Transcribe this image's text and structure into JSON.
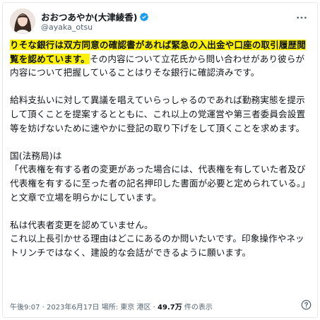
{
  "author": {
    "display_name": "おおつあやか(大津綾香)",
    "handle": "@ayaka_otsu",
    "verified": true,
    "verified_color": "#1d9bf0"
  },
  "post": {
    "p1_highlight": "りそな銀行は双方同意の確認書があれば緊急の入出金や口座の取引履歴閲覧を認めています。",
    "p1_rest": "その内容について立花氏から問い合わせがあり彼らが内容について把握していることはりそな銀行に確認済みです。",
    "p2": "給料支払いに対して異議を唱えていらっしゃるのであれば勤務実態を提示して頂くことを提案するとともに、これ以上の党運営や第三者委員会設置等を妨げないために速やかに登記の取り下げをして頂くことを求めます。",
    "p3": "国(法務局)は\n「代表権を有する者の変更があった場合には、代表権を有していた者及び代表権を有するに至った者の記名押印した書面が必要と定められている。」と文章で立場を明らかにしています。",
    "p4": "私は代表者変更を認めていません。\nこれ以上長引かせる理由はどこにあるのか問いたいです。印象操作やネットリンチではなく、建設的な会話ができるように願います。",
    "highlight_color": "#fff200"
  },
  "meta": {
    "time": "午後9:07",
    "date": "2023年6月17日",
    "location": "場所: 東京 港区",
    "views_count": "49.7万",
    "views_label": "件の表示"
  },
  "icons": {
    "more": "more-horizontal-icon",
    "help": "help-circle-icon",
    "verified": "verified-badge-icon"
  }
}
